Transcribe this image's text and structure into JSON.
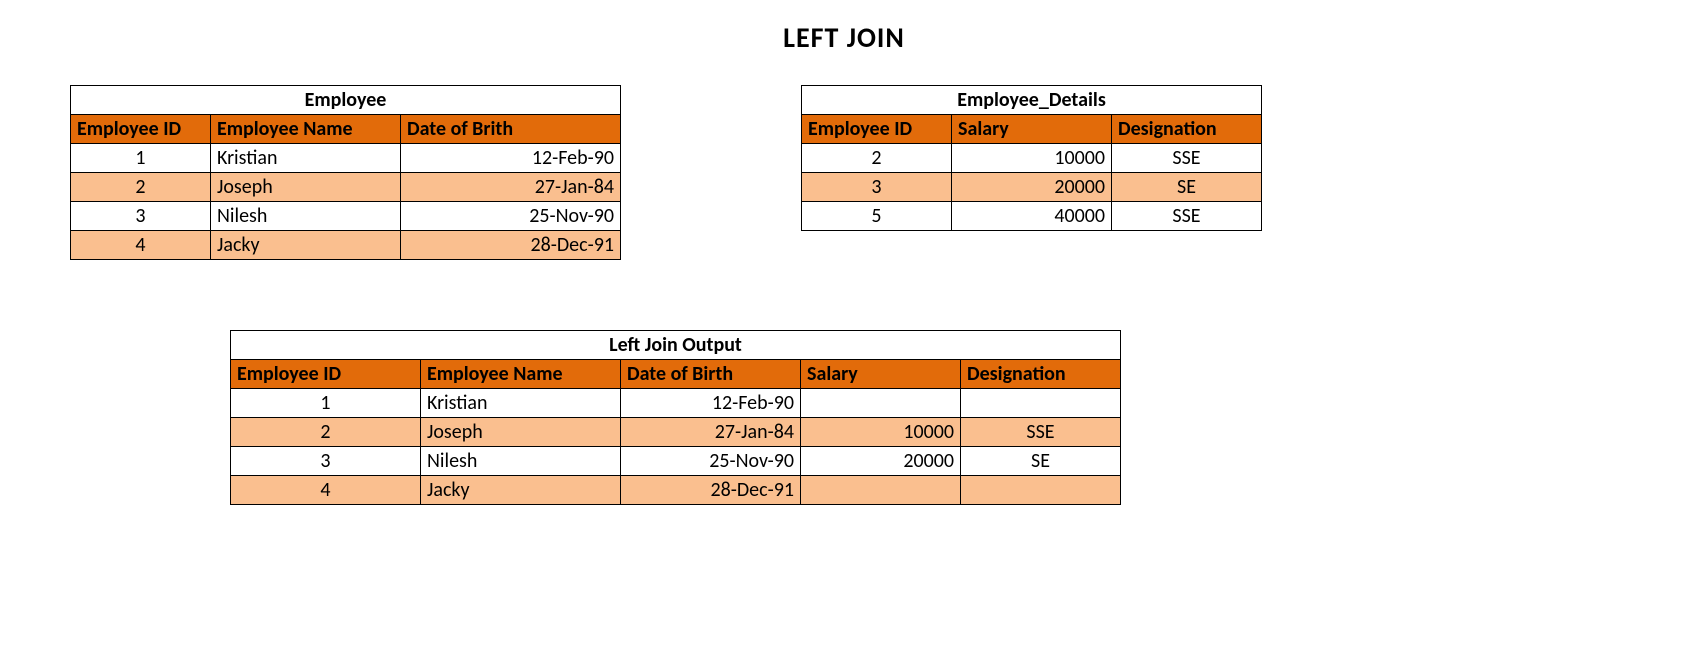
{
  "title": "LEFT JOIN",
  "employee": {
    "caption": "Employee",
    "headers": {
      "id": "Employee ID",
      "name": "Employee Name",
      "dob": "Date of Brith"
    },
    "rows": [
      {
        "id": "1",
        "name": "Kristian",
        "dob": "12-Feb-90"
      },
      {
        "id": "2",
        "name": "Joseph",
        "dob": "27-Jan-84"
      },
      {
        "id": "3",
        "name": "Nilesh",
        "dob": "25-Nov-90"
      },
      {
        "id": "4",
        "name": "Jacky",
        "dob": "28-Dec-91"
      }
    ]
  },
  "details": {
    "caption": "Employee_Details",
    "headers": {
      "id": "Employee ID",
      "salary": "Salary",
      "desig": "Designation"
    },
    "rows": [
      {
        "id": "2",
        "salary": "10000",
        "desig": "SSE"
      },
      {
        "id": "3",
        "salary": "20000",
        "desig": "SE"
      },
      {
        "id": "5",
        "salary": "40000",
        "desig": "SSE"
      }
    ]
  },
  "output": {
    "caption": "Left Join Output",
    "headers": {
      "id": "Employee ID",
      "name": "Employee Name",
      "dob": "Date of Birth",
      "salary": "Salary",
      "desig": "Designation"
    },
    "rows": [
      {
        "id": "1",
        "name": "Kristian",
        "dob": "12-Feb-90",
        "salary": "",
        "desig": ""
      },
      {
        "id": "2",
        "name": "Joseph",
        "dob": "27-Jan-84",
        "salary": "10000",
        "desig": "SSE"
      },
      {
        "id": "3",
        "name": "Nilesh",
        "dob": "25-Nov-90",
        "salary": "20000",
        "desig": "SE"
      },
      {
        "id": "4",
        "name": "Jacky",
        "dob": "28-Dec-91",
        "salary": "",
        "desig": ""
      }
    ]
  }
}
